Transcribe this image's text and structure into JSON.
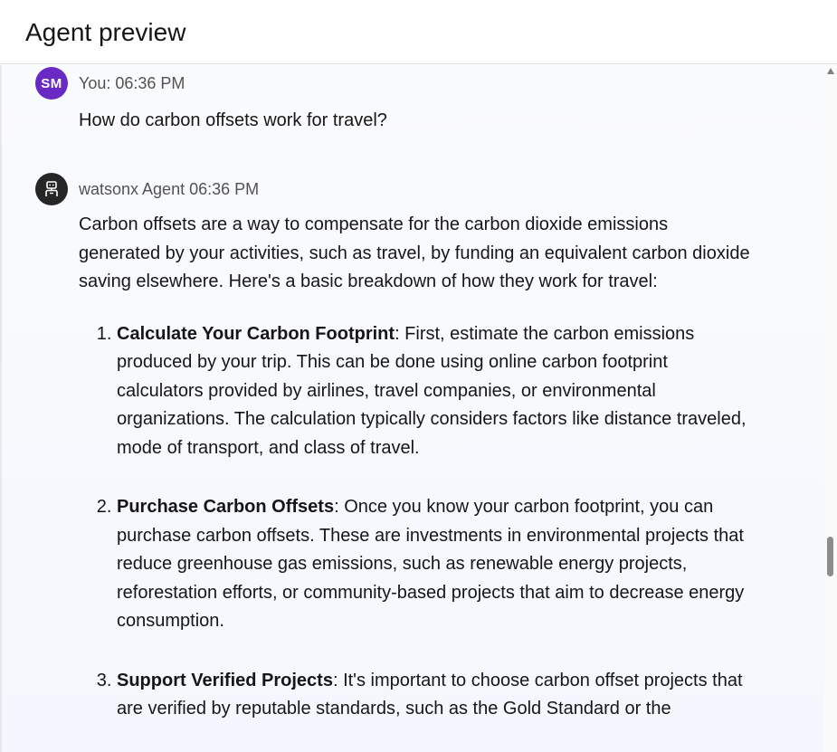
{
  "header": {
    "title": "Agent preview"
  },
  "conversation": {
    "user": {
      "avatar_initials": "SM",
      "avatar_color": "#6929c4",
      "meta": "You: 06:36 PM",
      "message": "How do carbon offsets work for travel?"
    },
    "agent": {
      "avatar_icon": "robot-icon",
      "avatar_color": "#262626",
      "meta": "watsonx Agent 06:36 PM",
      "intro": "Carbon offsets are a way to compensate for the carbon dioxide emissions generated by your activities, such as travel, by funding an equivalent carbon dioxide saving elsewhere. Here's a basic breakdown of how they work for travel:",
      "steps": [
        {
          "title": "Calculate Your Carbon Footprint",
          "text": ": First, estimate the carbon emissions produced by your trip. This can be done using online carbon footprint calculators provided by airlines, travel companies, or environmental organizations. The calculation typically considers factors like distance traveled, mode of transport, and class of travel."
        },
        {
          "title": "Purchase Carbon Offsets",
          "text": ": Once you know your carbon footprint, you can purchase carbon offsets. These are investments in environmental projects that reduce greenhouse gas emissions, such as renewable energy projects, reforestation efforts, or community-based projects that aim to decrease energy consumption."
        },
        {
          "title": "Support Verified Projects",
          "text": ": It's important to choose carbon offset projects that are verified by reputable standards, such as the Gold Standard or the"
        }
      ]
    }
  },
  "scrollbar": {
    "up_icon": "scroll-up-arrow-icon"
  }
}
